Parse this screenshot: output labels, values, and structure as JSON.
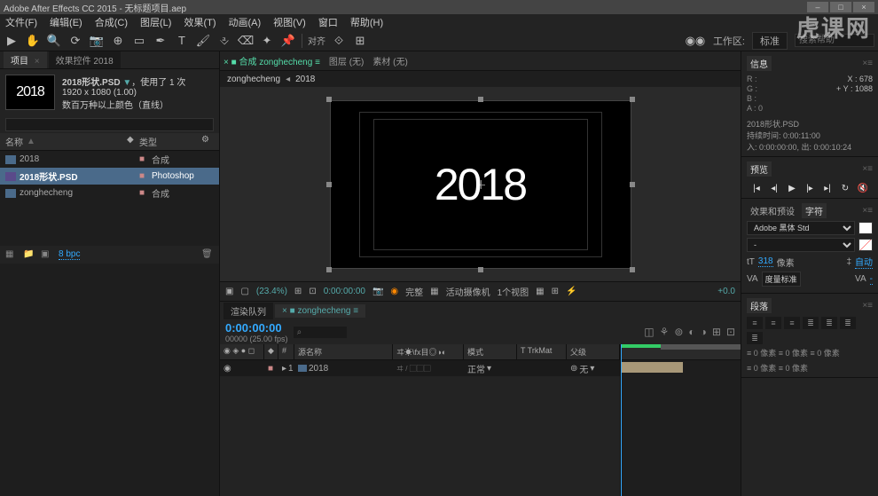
{
  "titlebar": {
    "text": "Adobe After Effects CC 2015 - 无标题项目.aep"
  },
  "menu": {
    "file": "文件(F)",
    "edit": "编辑(E)",
    "comp": "合成(C)",
    "layer": "图层(L)",
    "effect": "效果(T)",
    "anim": "动画(A)",
    "view": "视图(V)",
    "window": "窗口",
    "help": "帮助(H)"
  },
  "toolbar": {
    "snap": "对齐",
    "ws_label": "工作区:",
    "ws": "标准",
    "search": "搜索帮助"
  },
  "project": {
    "tab1": "项目",
    "tab2": "效果控件 2018",
    "title": "2018形状.PSD",
    "used": "，使用了 1 次",
    "dims": "1920 x 1080 (1.00)",
    "colors": "数百万种以上颜色（直线）",
    "thumb_text": "2018",
    "hdr_name": "名称",
    "hdr_type": "类型",
    "rows": [
      {
        "name": "2018",
        "type": "合成",
        "kind": "fcomp"
      },
      {
        "name": "2018形状.PSD",
        "type": "Photoshop",
        "kind": "fpsd"
      },
      {
        "name": "zonghecheng",
        "type": "合成",
        "kind": "fcomp"
      }
    ],
    "bpc": "8 bpc"
  },
  "comp": {
    "tab_pre": "■ 合成",
    "tab_active": "zonghecheng",
    "tab_fc": "图层 (无)",
    "tab_src": "素材 (无)",
    "crumb": "zonghecheng",
    "crumb2": "2018",
    "canvas_text": "2018",
    "zoom": "(23.4%)",
    "time": "0:00:00:00",
    "qual": "完整",
    "cam": "活动摄像机",
    "view": "1个视图"
  },
  "timeline": {
    "tab1": "渲染队列",
    "tab2": "zonghecheng",
    "time": "0:00:00:00",
    "fps": "00000 (25.00 fps)",
    "hdr_src": "源名称",
    "hdr_switch": "ヰ☀\\fx目◎◑◐",
    "hdr_mode": "模式",
    "hdr_trk": "T  TrkMat",
    "hdr_parent": "父级",
    "row": {
      "num": "1",
      "name": "2018",
      "mode": "正常",
      "parent": "无"
    }
  },
  "rpanel": {
    "info": {
      "tab": "信息",
      "r": "R :",
      "g": "G :",
      "b": "B :",
      "a": "A :  0",
      "x": "X : 678",
      "y": "+ Y : 1088",
      "line1": "2018形状.PSD",
      "line2": "持续时间: 0:00:11:00",
      "line3": "入: 0:00:00:00, 出: 0:00:10:24"
    },
    "preview": {
      "tab": "预览"
    },
    "char": {
      "tab1": "效果和预设",
      "tab2": "字符",
      "font": "Adobe 黑体 Std",
      "size": "318",
      "size_u": "像素",
      "lead": "自动",
      "kern": "度量标准"
    },
    "para": {
      "tab": "段落"
    },
    "align_txt1": "≡ 0 像素   ≡ 0 像素   ≡ 0 像素",
    "align_txt2": "≡ 0 像素   ≡ 0 像素"
  },
  "watermark": "虎课网"
}
